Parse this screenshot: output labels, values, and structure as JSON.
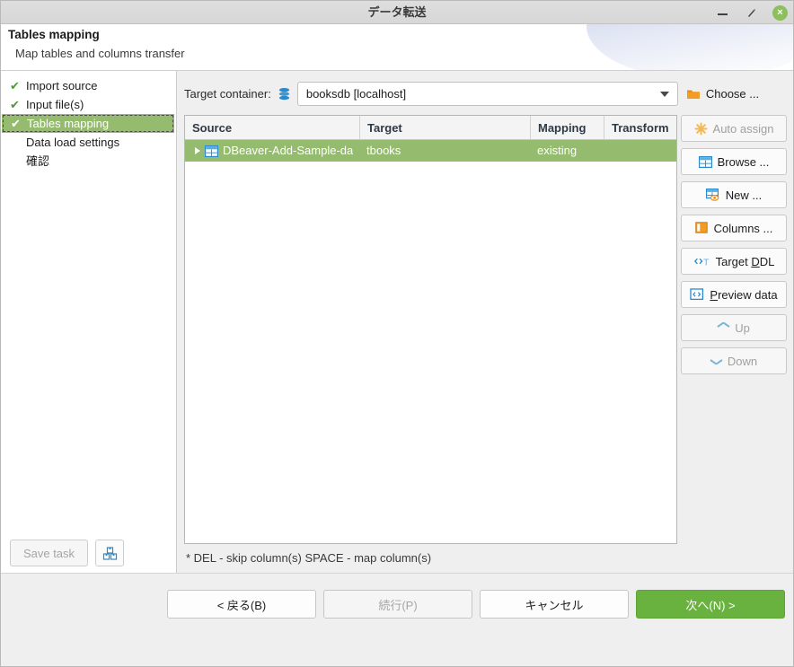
{
  "window": {
    "title": "データ転送",
    "controls": {
      "minimize": "minimize-button",
      "maximize": "maximize-button",
      "close": "×"
    }
  },
  "header": {
    "title": "Tables mapping",
    "subtitle": "Map tables and columns transfer"
  },
  "sidebar": {
    "steps": [
      {
        "label": "Import source",
        "done": true,
        "current": false,
        "check": "✔"
      },
      {
        "label": "Input file(s)",
        "done": true,
        "current": false,
        "check": "✔"
      },
      {
        "label": "Tables mapping",
        "done": true,
        "current": true,
        "check": "✔"
      },
      {
        "label": "Data load settings",
        "done": false,
        "current": false,
        "check": ""
      },
      {
        "label": "確認",
        "done": false,
        "current": false,
        "check": ""
      }
    ],
    "save_task_label": "Save task",
    "save_task_enabled": false,
    "stack_icon": "boxes-icon"
  },
  "main": {
    "target_container_label": "Target container:",
    "target_container_icon": "database-icon",
    "target_container_value": "booksdb  [localhost]",
    "choose_label": "Choose ...",
    "choose_icon": "folder-icon",
    "table": {
      "columns": [
        "Source",
        "Target",
        "Mapping",
        "Transform"
      ],
      "rows": [
        {
          "source": "DBeaver-Add-Sample-da",
          "source_icon": "table-icon",
          "target": "tbooks",
          "mapping": "existing",
          "transform": "",
          "selected": true,
          "expandable": true
        }
      ]
    },
    "hint": "* DEL - skip column(s)  SPACE - map column(s)",
    "side_buttons": [
      {
        "label": "Auto assign",
        "icon": "asterisk-icon",
        "enabled": false
      },
      {
        "label": "Browse ...",
        "icon": "table-icon",
        "enabled": true
      },
      {
        "label": "New ...",
        "icon": "table-new-icon",
        "enabled": true
      },
      {
        "label": "Columns ...",
        "icon": "columns-icon",
        "enabled": true
      },
      {
        "label": "Target DDL",
        "icon": "ddl-icon",
        "enabled": true,
        "mnemonic": "D"
      },
      {
        "label": "Preview data",
        "icon": "preview-icon",
        "enabled": true,
        "mnemonic": "P"
      },
      {
        "label": "Up",
        "icon": "chevron-up-icon",
        "enabled": false
      },
      {
        "label": "Down",
        "icon": "chevron-down-icon",
        "enabled": false
      }
    ]
  },
  "footer": {
    "back_label": "< 戻る(B)",
    "continue_label": "続行(P)",
    "cancel_label": "キャンセル",
    "next_label": "次へ(N) >"
  },
  "colors": {
    "primary_green": "#6ab23f",
    "selection_green": "#94bb6e",
    "check_green": "#4b9b34",
    "accent_blue": "#2d89c8",
    "accent_orange": "#e98c1e"
  }
}
